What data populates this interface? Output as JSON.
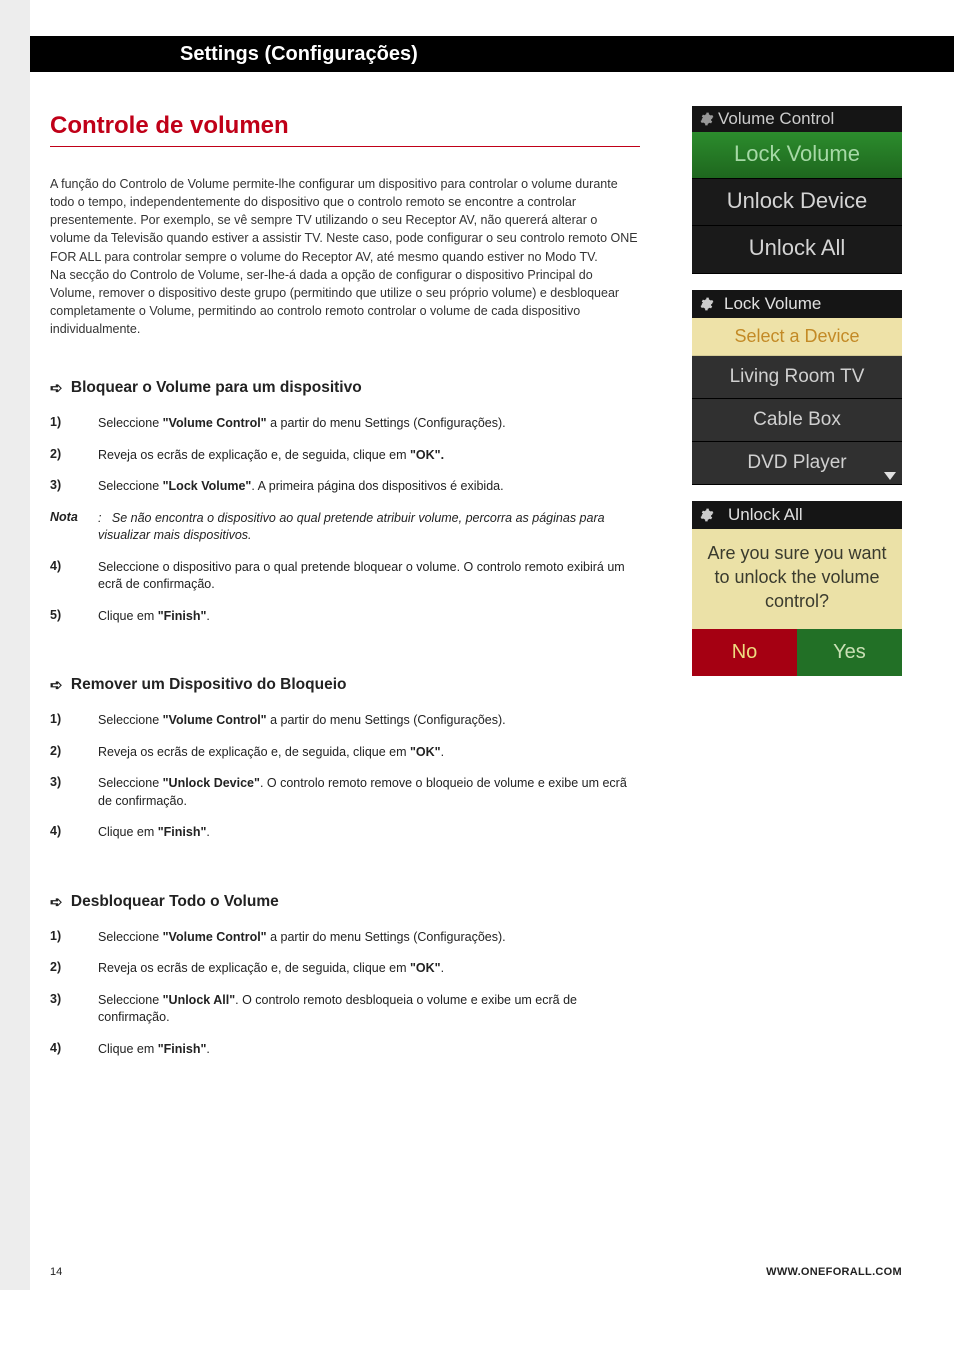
{
  "page_title": "Settings (Configurações)",
  "section_title": "Controle de volumen",
  "intro_text": "A função do Controlo de Volume permite-lhe configurar um dispositivo para controlar o volume durante todo o tempo, independentemente do dispositivo que o controlo remoto se encontre a controlar presentemente.   Por exemplo, se vê sempre TV utilizando o seu Receptor AV, não quererá alterar o volume da Televisão quando estiver a assistir TV. Neste caso, pode configurar o seu controlo remoto ONE FOR ALL para controlar sempre o volume do Receptor AV, até mesmo quando estiver no Modo TV.\nNa secção do Controlo de Volume, ser-lhe-á dada a opção de configurar o dispositivo Principal do Volume, remover o dispositivo deste grupo (permitindo que utilize o seu próprio volume) e desbloquear completamente o Volume, permitindo ao controlo remoto controlar o volume de cada dispositivo individualmente.",
  "sub1": {
    "heading": "Bloquear o Volume para um dispositivo",
    "steps": {
      "s1_a": "Seleccione ",
      "s1_b": "\"Volume Control\"",
      "s1_c": " a partir do menu Settings (Configurações).",
      "s2_a": "Reveja os ecrãs de explicação e, de seguida, clique em ",
      "s2_b": "\"OK\".",
      "s3_a": "Seleccione ",
      "s3_b": "\"Lock Volume\"",
      "s3_c": ". A primeira página dos dispositivos é exibida.",
      "note_lbl": "Nota",
      "note_txt": ":   Se não encontra o dispositivo ao qual pretende atribuir volume, percorra as páginas para visualizar mais dispositivos.",
      "s4": "Seleccione o dispositivo para o qual pretende bloquear o volume. O controlo remoto exibirá um ecrã de confirmação.",
      "s5_a": "Clique em ",
      "s5_b": "\"Finish\"",
      "s5_c": "."
    }
  },
  "sub2": {
    "heading": "Remover um Dispositivo do Bloqueio",
    "steps": {
      "s1_a": "Seleccione ",
      "s1_b": "\"Volume Control\"",
      "s1_c": " a partir do menu Settings (Configurações).",
      "s2_a": "Reveja os ecrãs de explicação e, de seguida, clique em ",
      "s2_b": "\"OK\"",
      "s2_c": ".",
      "s3_a": "Seleccione ",
      "s3_b": "\"Unlock Device\"",
      "s3_c": ". O controlo remoto remove o bloqueio de volume e exibe um ecrã de confirmação.",
      "s4_a": "Clique em ",
      "s4_b": "\"Finish\"",
      "s4_c": "."
    }
  },
  "sub3": {
    "heading": "Desbloquear Todo o Volume",
    "steps": {
      "s1_a": "Seleccione ",
      "s1_b": "\"Volume Control\"",
      "s1_c": " a partir do menu Settings (Configurações).",
      "s2_a": "Reveja os ecrãs de explicação e, de seguida, clique em ",
      "s2_b": "\"OK\"",
      "s2_c": ".",
      "s3_a": "Seleccione ",
      "s3_b": "\"Unlock All\"",
      "s3_c": ". O controlo remoto desbloqueia o volume e exibe um ecrã de confirmação.",
      "s4_a": "Clique em ",
      "s4_b": "\"Finish\"",
      "s4_c": "."
    }
  },
  "screen1": {
    "header": "Volume Control",
    "row1": "Lock Volume",
    "row2": "Unlock Device",
    "row3": "Unlock All"
  },
  "screen2": {
    "header": "Lock Volume",
    "select": "Select a Device",
    "d1": "Living Room TV",
    "d2": "Cable Box",
    "d3": "DVD Player"
  },
  "screen3": {
    "header": "Unlock All",
    "confirm": "Are you sure you want to unlock the volume control?",
    "no": "No",
    "yes": "Yes"
  },
  "labels": {
    "n1": "1)",
    "n2": "2)",
    "n3": "3)",
    "n4": "4)",
    "n5": "5)"
  },
  "footer": {
    "page": "14",
    "url": "WWW.ONEFORALL.COM"
  }
}
